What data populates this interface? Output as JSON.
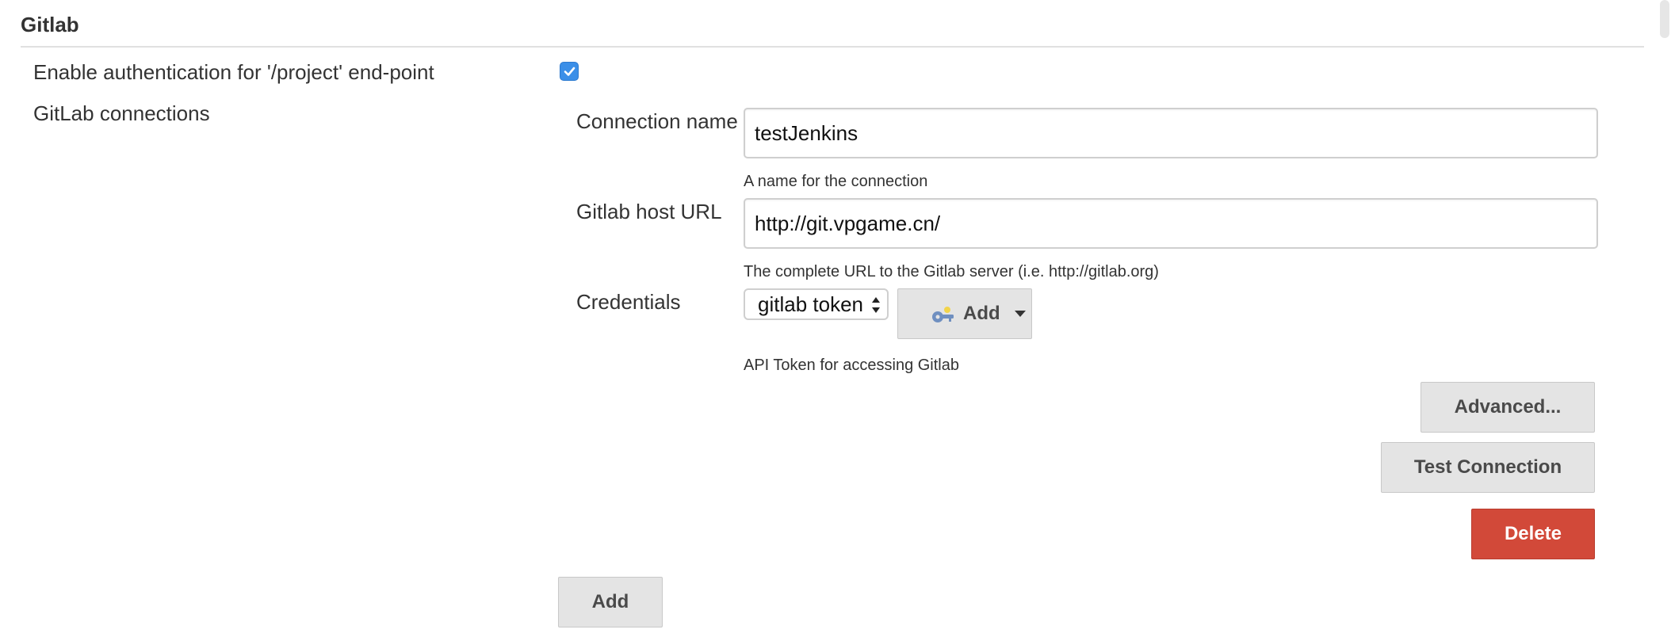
{
  "section": {
    "title": "Gitlab"
  },
  "auth": {
    "label": "Enable authentication for '/project' end-point",
    "checked": true
  },
  "connections": {
    "label": "GitLab connections",
    "connection_name": {
      "label": "Connection name",
      "value": "testJenkins",
      "help": "A name for the connection"
    },
    "host_url": {
      "label": "Gitlab host URL",
      "value": "http://git.vpgame.cn/",
      "help": "The complete URL to the Gitlab server (i.e. http://gitlab.org)"
    },
    "credentials": {
      "label": "Credentials",
      "selected": "gitlab token",
      "add_label": "Add",
      "add_icon": "key-icon",
      "help": "API Token for accessing Gitlab"
    },
    "advanced_label": "Advanced...",
    "test_label": "Test Connection",
    "delete_label": "Delete",
    "add_label": "Add"
  },
  "colors": {
    "checkbox": "#3b8fe8",
    "delete": "#d24939",
    "button": "#e4e4e4"
  }
}
